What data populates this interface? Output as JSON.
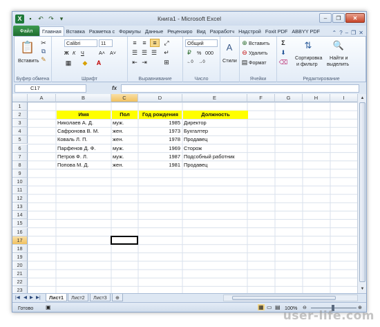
{
  "window": {
    "title": "Книга1  -  Microsoft Excel"
  },
  "titlebar": {
    "minimize": "–",
    "restore": "❐",
    "close": "✕"
  },
  "ribbon_tabs": [
    "Файл",
    "Главная",
    "Вставка",
    "Разметка с",
    "Формулы",
    "Данные",
    "Рецензиро",
    "Вид",
    "Разработч",
    "Надстрой",
    "Foxit PDF",
    "ABBYY PDF"
  ],
  "ribbon": {
    "clipboard": {
      "paste": "Вставить",
      "label": "Буфер обмена"
    },
    "font": {
      "name": "Calibri",
      "size": "11",
      "bold": "Ж",
      "italic": "К",
      "underline": "Ч",
      "grow": "A˄",
      "shrink": "A˅",
      "label": "Шрифт"
    },
    "alignment": {
      "label": "Выравнивание"
    },
    "number": {
      "format": "Общий",
      "percent": "%",
      "thousands": "000",
      "label": "Число"
    },
    "styles": {
      "label": "Стили"
    },
    "cells": {
      "insert": "Вставить",
      "delete": "Удалить",
      "format": "Формат",
      "label": "Ячейки"
    },
    "editing": {
      "sort": "Сортировка",
      "sort2": "и фильтр",
      "find": "Найти и",
      "find2": "выделить",
      "label": "Редактирование"
    }
  },
  "formula_bar": {
    "name_box": "C17",
    "fx": "fx",
    "value": ""
  },
  "columns": [
    "A",
    "B",
    "C",
    "D",
    "E",
    "F",
    "G",
    "H",
    "I"
  ],
  "selected_column": "C",
  "selected_row": "17",
  "rows": [
    "1",
    "2",
    "3",
    "4",
    "5",
    "6",
    "7",
    "8",
    "9",
    "10",
    "11",
    "12",
    "13",
    "14",
    "15",
    "16",
    "17",
    "18",
    "19",
    "20",
    "21",
    "22",
    "23"
  ],
  "table": {
    "headers": [
      "Имя",
      "Пол",
      "Год рождения",
      "Должность"
    ],
    "records": [
      [
        "Николаев А. Д.",
        "муж.",
        "1985",
        "Директор"
      ],
      [
        "Сафронова В. М.",
        "жен.",
        "1973",
        "Бухгалтер"
      ],
      [
        "Коваль Л. П.",
        "жен.",
        "1978",
        "Продавец"
      ],
      [
        "Парфенов Д. Ф.",
        "муж.",
        "1969",
        "Сторож"
      ],
      [
        "Петров Ф. Л.",
        "муж.",
        "1987",
        "Подсобный работник"
      ],
      [
        "Попова М. Д.",
        "жен.",
        "1981",
        "Продавец"
      ]
    ]
  },
  "sheets": [
    "Лист1",
    "Лист2",
    "Лист3"
  ],
  "active_sheet": "Лист1",
  "status": {
    "ready": "Готово",
    "zoom": "100%"
  },
  "watermark": "user-life.com",
  "colors": {
    "header_fill": "#ffff00",
    "file_tab": "#1f6e30",
    "selection": "#f1c15f"
  }
}
